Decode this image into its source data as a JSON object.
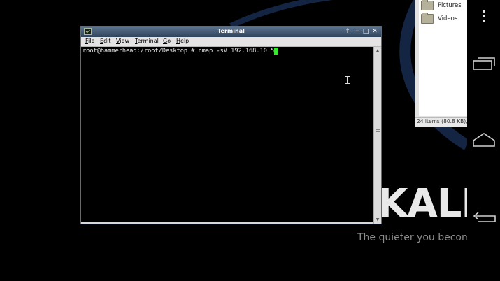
{
  "desktop": {
    "logo_text": "KALI",
    "tagline": "The quieter you become.",
    "colors": {
      "swoosh": "#142544",
      "logo": "#e9e9e9",
      "tagline": "#8c8c8c"
    }
  },
  "file_manager": {
    "items": [
      {
        "label": "Pictures",
        "icon": "folder-icon"
      },
      {
        "label": "Videos",
        "icon": "folder-icon"
      }
    ],
    "status_text": "24 items (80.8 KB),"
  },
  "terminal": {
    "title": "Terminal",
    "title_buttons": [
      "↑",
      "–",
      "□",
      "✕"
    ],
    "menu": [
      "File",
      "Edit",
      "View",
      "Terminal",
      "Go",
      "Help"
    ],
    "prompt": "root@hammerhead:/root/Desktop # ",
    "command": "nmap -sV 192.168.10.5",
    "colors": {
      "titlebar": "#3f5670",
      "cursor": "#37e82a",
      "text": "#e8e8e8"
    }
  },
  "navbar": {
    "buttons": [
      {
        "name": "menu",
        "icon": "overflow-menu-icon"
      },
      {
        "name": "recent-apps",
        "icon": "recent-apps-icon"
      },
      {
        "name": "home",
        "icon": "home-icon"
      },
      {
        "name": "back",
        "icon": "back-icon"
      }
    ]
  }
}
